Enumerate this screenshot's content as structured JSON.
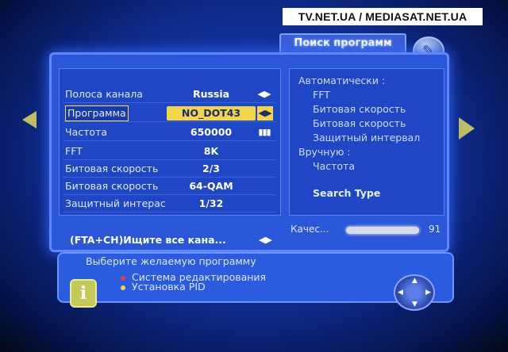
{
  "watermark": "TV.NET.UA / MEDIASAT.NET.UA",
  "screen_title": "Поиск программ",
  "left_rows": [
    {
      "label": "Полоса канала",
      "value": "Russia"
    },
    {
      "label": "Программа",
      "value": "NO_DOT43"
    },
    {
      "label": "Частота",
      "value": "650000"
    },
    {
      "label": "FFT",
      "value": "8K"
    },
    {
      "label": "Битовая скорость",
      "value": "2/3"
    },
    {
      "label": "Битовая скорость",
      "value": "64-QAM"
    },
    {
      "label": "Защитный интерас",
      "value": "1/32"
    }
  ],
  "scan_button": {
    "label": "(FTA+CH)Ищите все кана..."
  },
  "right_panel": {
    "auto_heading": "Автоматически :",
    "auto_items": [
      "FFT",
      "Битовая скорость",
      "Битовая скорость",
      "Защитный интервал"
    ],
    "manual_heading": "Вручную :",
    "manual_items": [
      "Частота"
    ],
    "search_type": "Search Type"
  },
  "quality": {
    "label": "Качес...",
    "value": "91",
    "percent": 91
  },
  "help": {
    "line1": "Выберите желаемую программу",
    "line2": "Система редактирования",
    "line3": "Установка PID",
    "bullet_colors": [
      "#e03a5a",
      "#e8d84a"
    ]
  },
  "icons": {
    "arrows": "◀▶",
    "signal": "▮▮▮",
    "info": "i"
  }
}
